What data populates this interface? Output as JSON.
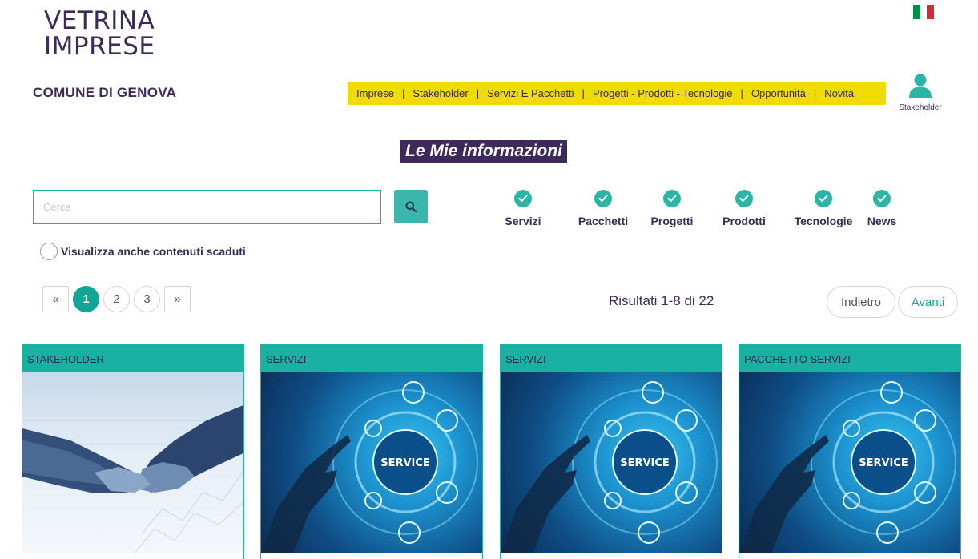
{
  "header": {
    "logo_line1": "VETRINA",
    "logo_line2": "IMPRESE",
    "comune": "COMUNE DI GENOVA",
    "language_flag": "italian-flag",
    "flag_colors": [
      "#009246",
      "#ffffff",
      "#ce2b37"
    ],
    "user_label": "Stakeholder"
  },
  "nav": {
    "items": [
      "Imprese",
      "Stakeholder",
      "Servizi E Pacchetti",
      "Progetti - Prodotti - Tecnologie",
      "Opportunità",
      "Novità"
    ],
    "separator": "|",
    "bg_color": "#f0dc00"
  },
  "page": {
    "title": "Le Mie informazioni"
  },
  "search": {
    "placeholder": "Cerca",
    "value": "",
    "button_icon": "search-icon"
  },
  "filters": [
    {
      "label": "Servizi",
      "checked": true
    },
    {
      "label": "Pacchetti",
      "checked": true
    },
    {
      "label": "Progetti",
      "checked": true
    },
    {
      "label": "Prodotti",
      "checked": true
    },
    {
      "label": "Tecnologie",
      "checked": true
    },
    {
      "label": "News",
      "checked": true
    }
  ],
  "expired": {
    "label": "Visualizza anche contenuti scaduti",
    "checked": false
  },
  "pagination": {
    "prev": "«",
    "pages": [
      "1",
      "2",
      "3"
    ],
    "current": "1",
    "next": "»"
  },
  "results": {
    "text": "Risultati 1-8 di 22"
  },
  "buttons": {
    "back": "Indietro",
    "next": "Avanti"
  },
  "cards": [
    {
      "category": "STAKEHOLDER",
      "image": "handshake-image"
    },
    {
      "category": "SERVIZI",
      "image": "service-hand-image"
    },
    {
      "category": "SERVIZI",
      "image": "service-hand-image"
    },
    {
      "category": "PACCHETTO SERVIZI",
      "image": "service-hand-image"
    }
  ],
  "colors": {
    "primary": "#3d2a5a",
    "accent": "#18b1a2",
    "nav_yellow": "#f0dc00"
  }
}
